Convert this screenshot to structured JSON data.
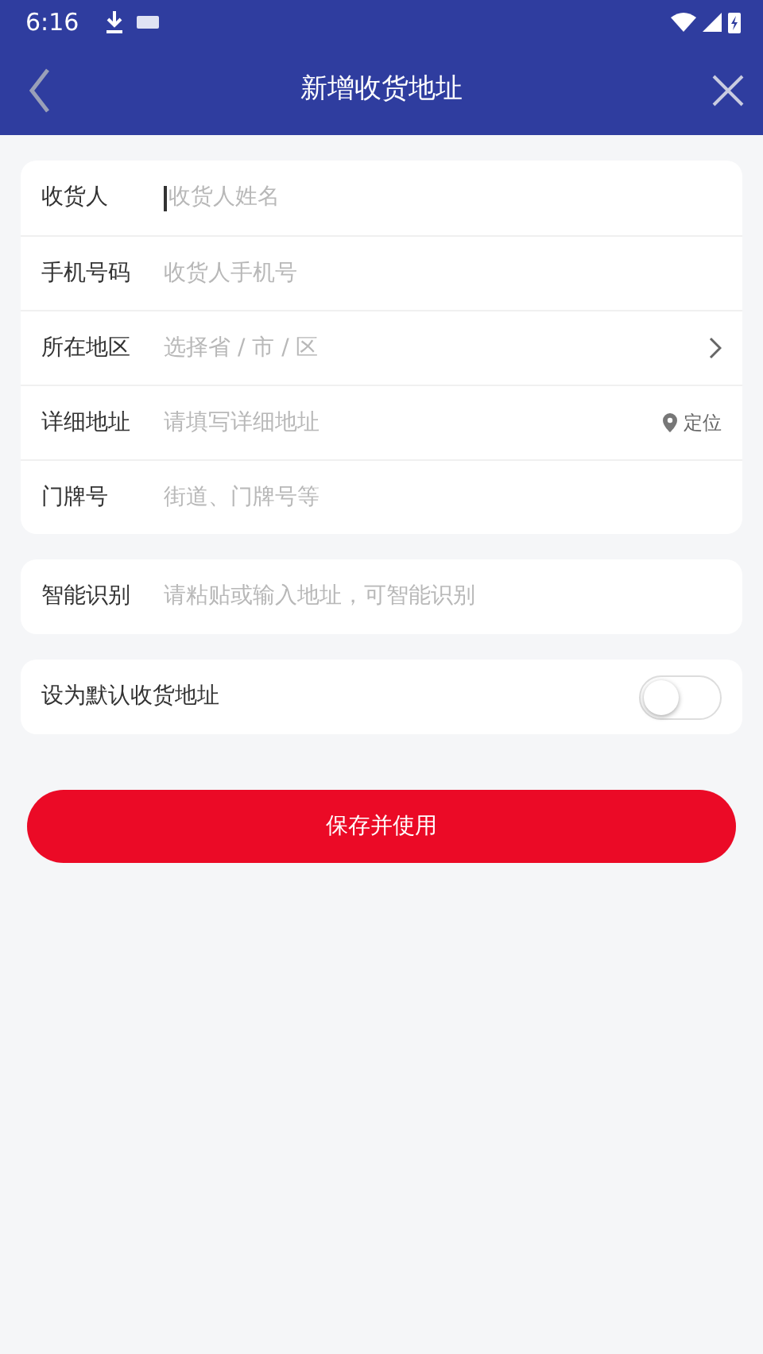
{
  "status_bar": {
    "time": "6:16"
  },
  "header": {
    "title": "新增收货地址"
  },
  "address_fields": [
    {
      "label": "收货人",
      "placeholder": "收货人姓名",
      "kind": "text",
      "focused": true
    },
    {
      "label": "手机号码",
      "placeholder": "收货人手机号",
      "kind": "text",
      "focused": false
    },
    {
      "label": "所在地区",
      "placeholder": "选择省 / 市 / 区",
      "kind": "select",
      "focused": false
    },
    {
      "label": "详细地址",
      "placeholder": "请填写详细地址",
      "kind": "locate",
      "action": "定位",
      "focused": false
    },
    {
      "label": "门牌号",
      "placeholder": "街道、门牌号等",
      "kind": "text",
      "focused": false
    }
  ],
  "smart_recognition": {
    "label": "智能识别",
    "placeholder": "请粘贴或输入地址，可智能识别"
  },
  "default_address": {
    "label": "设为默认收货地址",
    "on": false
  },
  "save_button": "保存并使用"
}
